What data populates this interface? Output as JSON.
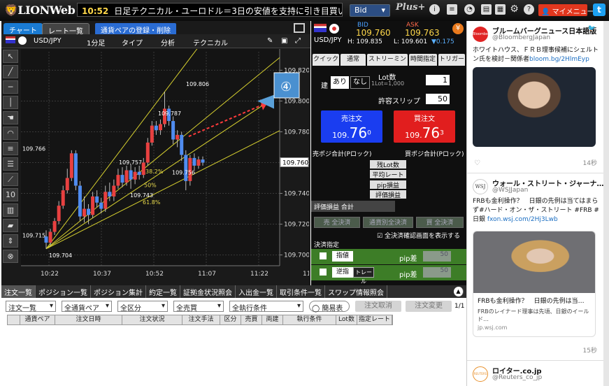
{
  "header": {
    "logo": "LIONWeb",
    "time": "10:52",
    "headline": "日足テクニカル・ユーロドル＝3日の安値を支持に引き目買いスタンス",
    "bid_select": "Bid",
    "plus_logo": "Plus+",
    "icons": [
      "info-icon",
      "wallet-icon",
      "pie-chart-icon",
      "document-icon",
      "gear-icon",
      "question-icon"
    ],
    "my_menu": "マイメニュー",
    "twitter_label": "t"
  },
  "chart_panel": {
    "tabs": [
      "チャート",
      "レート一覧"
    ],
    "register_link": "通貨ペアの登録・削除",
    "symbol": "USD/JPY",
    "period": "1分足",
    "type": "タイプ",
    "analysis": "分析",
    "technical": "テクニカル",
    "callout": "④",
    "fib_labels": [
      "38.2%",
      "50%",
      "61.8%"
    ],
    "point_labels": [
      "109.806",
      "109.787",
      "109.766",
      "109.757",
      "109.756",
      "109.743",
      "109.715",
      "109.704"
    ],
    "current_price": "109.760",
    "tool_hint": "10",
    "chart_data": {
      "type": "candlestick",
      "y_ticks": [
        109.82,
        109.8,
        109.78,
        109.76,
        109.74,
        109.72,
        109.7
      ],
      "y_tick_labels": [
        "109.820",
        "109.800",
        "109.780",
        "109.760",
        "109.740",
        "109.720",
        "109.700"
      ],
      "ylim": [
        109.693,
        109.832
      ],
      "x_tick_labels": [
        "10:22",
        "10:37",
        "10:52",
        "11:07",
        "11:22",
        "11:37"
      ],
      "candles": [
        [
          109.712,
          109.708,
          109.716,
          109.704
        ],
        [
          109.708,
          109.715,
          109.717,
          109.706
        ],
        [
          109.715,
          109.722,
          109.724,
          109.713
        ],
        [
          109.722,
          109.732,
          109.735,
          109.72
        ],
        [
          109.732,
          109.742,
          109.745,
          109.73
        ],
        [
          109.742,
          109.75,
          109.756,
          109.74
        ],
        [
          109.75,
          109.766,
          109.768,
          109.748
        ],
        [
          109.766,
          109.745,
          109.768,
          109.742
        ],
        [
          109.745,
          109.725,
          109.748,
          109.722
        ],
        [
          109.725,
          109.73,
          109.738,
          109.721
        ],
        [
          109.73,
          109.726,
          109.733,
          109.72
        ],
        [
          109.726,
          109.738,
          109.741,
          109.724
        ],
        [
          109.738,
          109.734,
          109.742,
          109.731
        ],
        [
          109.734,
          109.73,
          109.737,
          109.727
        ],
        [
          109.73,
          109.741,
          109.745,
          109.728
        ],
        [
          109.741,
          109.738,
          109.747,
          109.735
        ],
        [
          109.738,
          109.745,
          109.749,
          109.735
        ],
        [
          109.745,
          109.752,
          109.756,
          109.743
        ],
        [
          109.752,
          109.747,
          109.757,
          109.744
        ],
        [
          109.747,
          109.755,
          109.758,
          109.745
        ],
        [
          109.755,
          109.749,
          109.759,
          109.743
        ],
        [
          109.749,
          109.754,
          109.757,
          109.746
        ],
        [
          109.754,
          109.752,
          109.758,
          109.749
        ],
        [
          109.752,
          109.76,
          109.763,
          109.75
        ],
        [
          109.76,
          109.773,
          109.776,
          109.758
        ],
        [
          109.773,
          109.784,
          109.787,
          109.771
        ],
        [
          109.784,
          109.781,
          109.787,
          109.778
        ],
        [
          109.781,
          109.785,
          109.788,
          109.778
        ],
        [
          109.785,
          109.795,
          109.806,
          109.783
        ],
        [
          109.795,
          109.787,
          109.797,
          109.784
        ],
        [
          109.787,
          109.775,
          109.79,
          109.772
        ],
        [
          109.775,
          109.778,
          109.781,
          109.77
        ],
        [
          109.778,
          109.765,
          109.78,
          109.761
        ],
        [
          109.765,
          109.748,
          109.768,
          109.742
        ],
        [
          109.748,
          109.763,
          109.765,
          109.745
        ],
        [
          109.763,
          109.758,
          109.766,
          109.755
        ],
        [
          109.758,
          109.762,
          109.764,
          109.756
        ],
        [
          109.762,
          109.76,
          109.764,
          109.758
        ]
      ]
    }
  },
  "trade": {
    "pair": "USD/JPY",
    "bid_label": "BID",
    "bid_value": "109.760",
    "ask_label": "ASK",
    "ask_value": "109.763",
    "high": "H: 109.835",
    "low": "L: 109.601",
    "change": "▼0.175",
    "yen_icon": "¥",
    "tabs": [
      "クイック",
      "通常",
      "ストリーミング",
      "時間指定",
      "トリガー"
    ],
    "label_build": "建",
    "toggle_on": "あり",
    "toggle_off": "なし",
    "lot_label": "Lot数",
    "lot_sub": "1Lot=1,000",
    "lot_value": "1",
    "slip_label": "許容スリップ",
    "slip_value": "50",
    "sell_label": "売注文",
    "sell_price_small": "109.",
    "sell_price_big": "76",
    "sell_price_sup": "0",
    "buy_label": "買注文",
    "buy_price_small": "109.",
    "buy_price_big": "76",
    "buy_price_sup": "3",
    "sell_pos": "売ポジ合計(Pロック)",
    "buy_pos": "買ポジ合計(Pロック)",
    "rows": [
      "残Lot数",
      "平均レート",
      "pip損益",
      "評価損益"
    ],
    "eval_total": "評価損益 合計",
    "btns": [
      "売 全決済",
      "通貨別全決済",
      "買 全決済"
    ],
    "confirm": "全決済確認画面を表示する",
    "settle": "決済指定",
    "limit_btn": "指値",
    "stop_btn": "逆指",
    "trail_btn": "トレール",
    "pip_label": "pip差",
    "pip_values": [
      "50",
      "50"
    ]
  },
  "bottom": {
    "tabs": [
      "注文一覧",
      "ポジション一覧",
      "ポジション集計",
      "約定一覧",
      "証拠金状況照会",
      "入出金一覧",
      "取引条件一覧",
      "スワップ情報照会"
    ],
    "filters": [
      "注文一覧",
      "全通貨ペア",
      "全区分",
      "全売買",
      "全執行条件"
    ],
    "simple": "簡易表示",
    "cancel": "注文取消",
    "change": "注文変更",
    "page": "1/1",
    "columns": [
      "通貨ペア",
      "注文日時",
      "注文状況",
      "注文手法",
      "区分",
      "売買",
      "両建",
      "執行条件",
      "Lot数",
      "指定レート"
    ]
  },
  "feed": {
    "tweets": [
      {
        "name": "ブルームバーグニュース日本語版",
        "handle": "@BloombergJapan",
        "text": "ホワイトハウス、ＦＲＢ理事候補にシェルトン氏を検討－関係者",
        "link": "bloom.bg/2HlmEyp",
        "time": "14秒",
        "avatar": "Bloomberg Japan"
      },
      {
        "name": "ウォール・ストリート・ジャーナ…",
        "handle": "@WSJJapan",
        "text": "FRBも金利操作？　日銀の先例は当てはまらず#ハード・オン・ザ・ストリート #FRB #日銀",
        "link": "fxon.wsj.com/2Hj3Lwb",
        "time": "15秒",
        "avatar": "WSJ",
        "card_title": "FRBも金利操作？　日銀の先例は当…",
        "card_text": "FRBのレイナード理事は先頃、日銀のイールド…",
        "card_link": "jp.wsj.com"
      },
      {
        "name": "ロイター.co.jp",
        "handle": "@Reuters_co_jp",
        "avatar": "REUTERS"
      }
    ]
  }
}
